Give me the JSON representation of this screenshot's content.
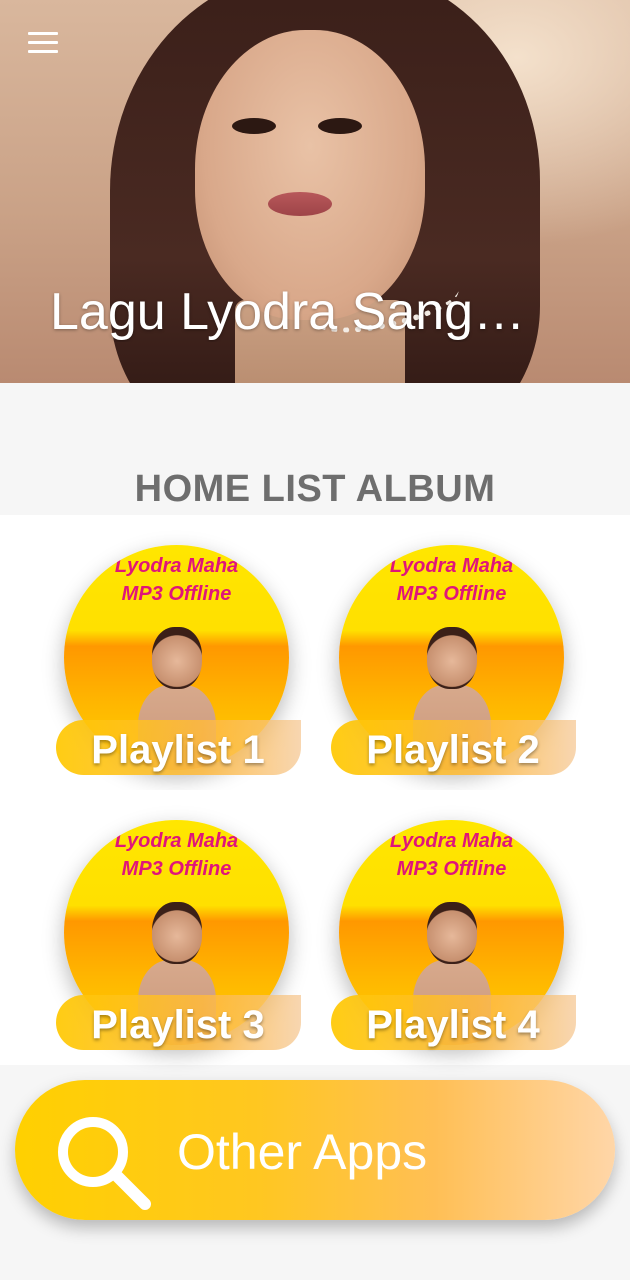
{
  "header": {
    "title": "Lagu Lyodra Sang…",
    "menu_icon": "hamburger-menu-icon"
  },
  "section": {
    "title": "HOME LIST ALBUM"
  },
  "playlists": [
    {
      "label": "Playlist 1",
      "thumb_line1": "Lyodra Maha",
      "thumb_line2": "MP3 Offline"
    },
    {
      "label": "Playlist 2",
      "thumb_line1": "Lyodra Maha",
      "thumb_line2": "MP3 Offline"
    },
    {
      "label": "Playlist 3",
      "thumb_line1": "Lyodra Maha",
      "thumb_line2": "MP3 Offline"
    },
    {
      "label": "Playlist 4",
      "thumb_line1": "Lyodra Maha",
      "thumb_line2": "MP3 Offline"
    }
  ],
  "other_apps": {
    "label": "Other Apps",
    "icon": "search-icon"
  },
  "colors": {
    "accent_yellow": "#ffd000",
    "accent_peach": "#ffd6a8",
    "section_title": "#6e6e6e"
  }
}
